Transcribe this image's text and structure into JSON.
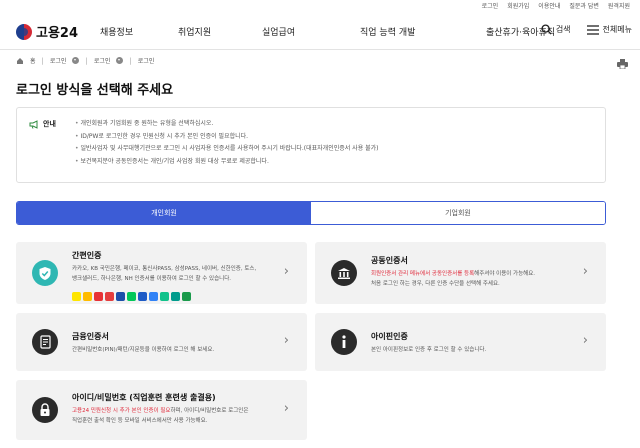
{
  "top_links": [
    "로그인",
    "회원가입",
    "이용안내",
    "질문과 답변",
    "원격지원"
  ],
  "header": {
    "logo_text": "고용24",
    "nav": [
      "채용정보",
      "취업지원",
      "실업급여",
      "직업 능력 개발",
      "출산휴가·육아휴직"
    ],
    "search_label": "검색",
    "menu_label": "전체메뉴"
  },
  "breadcrumb": {
    "home": "홈",
    "items": [
      "로그인",
      "로그인",
      "로그인"
    ]
  },
  "page_title": "로그인 방식을 선택해 주세요",
  "notice": {
    "label": "안내",
    "items": [
      "개인회원과 기업회원 중 원하는 유형을 선택하십시오.",
      "ID/PW로 로그인한 경우 민원신청 시 추가 본인 인증이 필요합니다.",
      "일반사업자 및 사무대행기관으로 로그인 시 사업자용 인증서를 사용하여 주시기 바랍니다.(대표자개인인증서 사용 불가)",
      "보건복지분야 공동인증서는 개인/기업 사업장 회원 대상 무료로 제공합니다."
    ]
  },
  "tabs": {
    "personal": "개인회원",
    "corporate": "기업회원"
  },
  "cards": {
    "simple": {
      "title": "간편인증",
      "desc_1": "카카오, KB 국민은행, 페이코, 통신사PASS, 삼성PASS, 네이버, 신한인증, 토스,",
      "desc_2": "뱅크샐러드, 하나은행, NH 인증서를 이용하여 로그인 할 수 있습니다."
    },
    "public_cert": {
      "title": "공동인증서",
      "desc_red": "회원인증서 관리 메뉴에서 공동인증서를 등록",
      "desc_rest": "해주셔야 이용이 가능해요.",
      "desc_2": "처음 로그인 하는 경우, 다른 인증 수단을 선택해 주세요."
    },
    "financial_cert": {
      "title": "금융인증서",
      "desc": "간편비밀번호(PIN)/패턴/지문등을 이용하여 로그인 해 보세요."
    },
    "ipin": {
      "title": "아이핀인증",
      "desc": "본인 아이핀정보로 인증 후 로그인 할 수 있습니다."
    },
    "idpw": {
      "title": "아이디/비밀번호 (직업훈련 훈련생 출결용)",
      "desc_red": "고용24 민원신청 시 추가 본인 인증이 필요",
      "desc_rest": "하며, 아이디/비밀번호로 로그인은",
      "desc_2": "직업훈련 출석 확인 등 모바일 서비스에서만 사용 가능해요."
    }
  },
  "colors": {
    "accent": "#3c5cd6",
    "warning_red": "#e0293a",
    "card_bg": "#f2f2f2"
  },
  "icons": {
    "simple": "shield-check-icon",
    "public_cert": "bank-icon",
    "financial_cert": "document-icon",
    "ipin": "info-icon",
    "idpw": "lock-icon"
  }
}
